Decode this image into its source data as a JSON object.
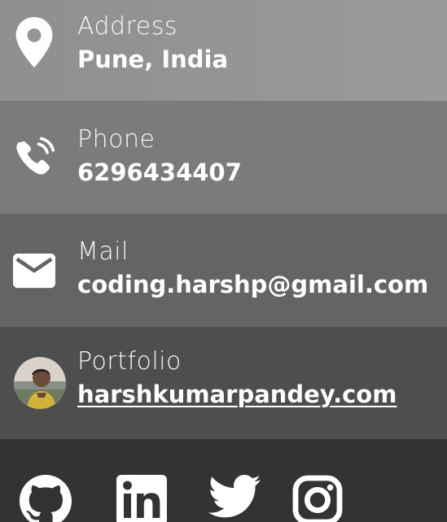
{
  "contact": {
    "address": {
      "label": "Address",
      "value": "Pune, India",
      "icon": "map-pin-icon"
    },
    "phone": {
      "label": "Phone",
      "value": "6296434407",
      "icon": "phone-icon"
    },
    "mail": {
      "label": "Mail",
      "value": "coding.harshp@gmail.com",
      "icon": "mail-icon"
    },
    "portfolio": {
      "label": "Portfolio",
      "value": "harshkumarpandey.com",
      "icon": "avatar"
    }
  },
  "social": [
    {
      "name": "GitHub",
      "icon": "github-icon"
    },
    {
      "name": "LinkedIn",
      "icon": "linkedin-icon"
    },
    {
      "name": "Twitter",
      "icon": "twitter-icon"
    },
    {
      "name": "Instagram",
      "icon": "instagram-icon"
    }
  ],
  "colors": {
    "row_address": "#949494",
    "row_phone": "#7b7b7b",
    "row_mail": "#646464",
    "row_portfolio": "#4e4e4e",
    "footer": "#333333",
    "text": "#ffffff"
  }
}
